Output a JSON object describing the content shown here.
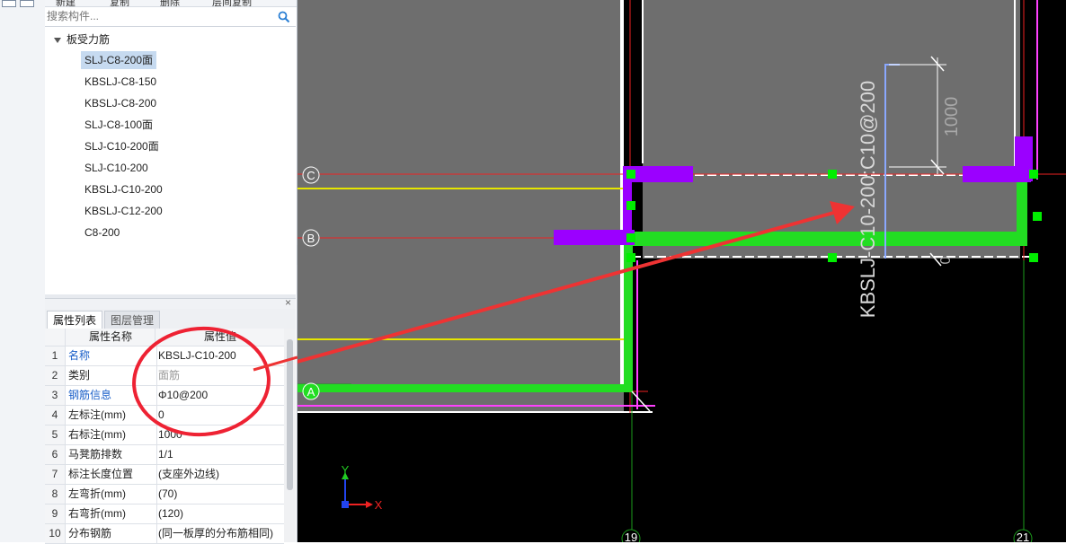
{
  "toolbar": {
    "items": [
      "新建",
      "复制",
      "删除",
      "层间复制"
    ]
  },
  "search": {
    "placeholder": "搜索构件..."
  },
  "tree": {
    "root": "板受力筋",
    "items": [
      "SLJ-C8-200面",
      "KBSLJ-C8-150",
      "KBSLJ-C8-200",
      "SLJ-C8-100面",
      "SLJ-C10-200面",
      "SLJ-C10-200",
      "KBSLJ-C10-200",
      "KBSLJ-C12-200",
      "C8-200"
    ],
    "selected_index": 0
  },
  "props": {
    "tabs": [
      "属性列表",
      "图层管理"
    ],
    "active_tab": 0,
    "col_name": "属性名称",
    "col_value": "属性值",
    "rows": [
      {
        "num": "1",
        "name": "名称",
        "value": "KBSLJ-C10-200"
      },
      {
        "num": "2",
        "name": "类别",
        "value": "面筋"
      },
      {
        "num": "3",
        "name": "钢筋信息",
        "value": "Φ10@200"
      },
      {
        "num": "4",
        "name": "左标注(mm)",
        "value": "0"
      },
      {
        "num": "5",
        "name": "右标注(mm)",
        "value": "1000"
      },
      {
        "num": "6",
        "name": "马凳筋排数",
        "value": "1/1"
      },
      {
        "num": "7",
        "name": "标注长度位置",
        "value": "(支座外边线)"
      },
      {
        "num": "8",
        "name": "左弯折(mm)",
        "value": "(70)"
      },
      {
        "num": "9",
        "name": "右弯折(mm)",
        "value": "(120)"
      },
      {
        "num": "10",
        "name": "分布钢筋",
        "value": "(同一板厚的分布筋相同)"
      }
    ]
  },
  "canvas": {
    "axis_labels": {
      "c": "C",
      "b": "B",
      "a": "A",
      "n19": "19",
      "n21": "21"
    },
    "rebar_label": "KBSLJ-C10-200:C10@200",
    "dim_1000": "1000",
    "dim_0": "0",
    "ucs_x": "X",
    "ucs_y": "Y"
  },
  "colors": {
    "selection": "#c6daf0",
    "link_blue": "#1a5fc8",
    "slab_gray": "#6e6e6e",
    "rebar_green": "#22dd22",
    "support_purple": "#9b00ff",
    "annotation_red": "#ee3333",
    "axis_yellow": "#e6e600"
  }
}
